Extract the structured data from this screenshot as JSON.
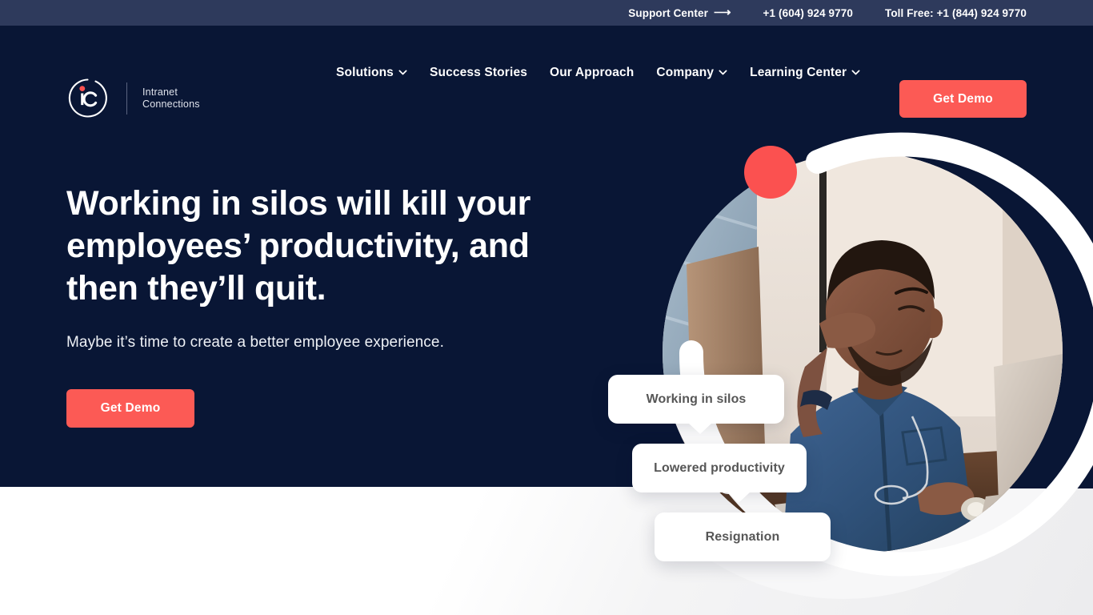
{
  "topbar": {
    "support": {
      "label": "Support Center",
      "icon": "long-arrow-right-icon",
      "glyph": "⟶"
    },
    "phone_primary": "+1 (604) 924 9770",
    "phone_tollfree": "Toll Free: +1 (844) 924 9770"
  },
  "brand": {
    "monogram": "IC",
    "name": "Intranet\nConnections",
    "accent_color": "#fb5150"
  },
  "nav": {
    "items": [
      {
        "label": "Solutions",
        "has_dropdown": true,
        "icon": "chevron-down-icon"
      },
      {
        "label": "Success Stories",
        "has_dropdown": false,
        "icon": ""
      },
      {
        "label": "Our Approach",
        "has_dropdown": false,
        "icon": ""
      },
      {
        "label": "Company",
        "has_dropdown": true,
        "icon": "chevron-down-icon"
      },
      {
        "label": "Learning Center",
        "has_dropdown": true,
        "icon": "chevron-down-icon"
      }
    ],
    "cta_label": "Get Demo"
  },
  "hero": {
    "headline": "Working in silos will kill your\nemployees’ productivity, and\nthen they’ll quit.",
    "subhead": "Maybe it’s time to create a better employee experience.",
    "cta_label": "Get Demo",
    "background_color": "#091635",
    "accent_color": "#fc5a55"
  },
  "visual": {
    "photo_alt": "Frustrated man at a desk rubbing his eyes in front of a laptop",
    "decor_circle_color": "#fb5150",
    "ring_color": "#ffffff",
    "bubbles": [
      {
        "label": "Working in silos"
      },
      {
        "label": "Lowered productivity"
      },
      {
        "label": "Resignation"
      }
    ]
  }
}
